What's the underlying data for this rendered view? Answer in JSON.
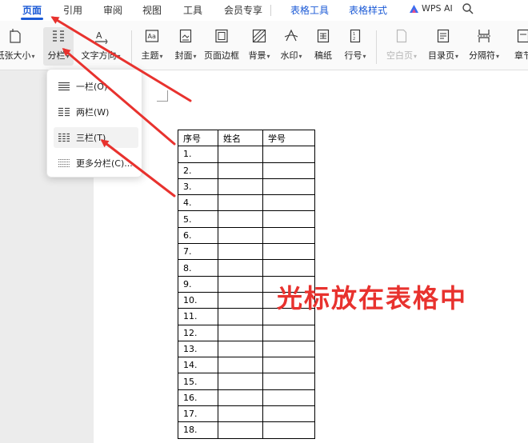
{
  "menu": {
    "tabs": [
      "页面",
      "引用",
      "审阅",
      "视图",
      "工具",
      "会员专享"
    ],
    "table_tabs": [
      "表格工具",
      "表格样式"
    ],
    "wps_ai": "WPS AI"
  },
  "ribbon": {
    "paper_size": "纸张大小",
    "columns": "分栏",
    "text_direction": "文字方向",
    "theme": "主题",
    "cover": "封面",
    "page_border": "页面边框",
    "background": "背景",
    "watermark": "水印",
    "manuscript": "稿纸",
    "line_number": "行号",
    "blank_page": "空白页",
    "toc_page": "目录页",
    "separator": "分隔符",
    "section": "章节"
  },
  "columns_menu": {
    "items": [
      "一栏(O)",
      "两栏(W)",
      "三栏(T)",
      "更多分栏(C)..."
    ]
  },
  "table": {
    "headers": [
      "序号",
      "姓名",
      "学号"
    ],
    "rows": [
      "1.",
      "2.",
      "3.",
      "4.",
      "5.",
      "6.",
      "7.",
      "8.",
      "9.",
      "10.",
      "11.",
      "12.",
      "13.",
      "14.",
      "15.",
      "16.",
      "17.",
      "18."
    ]
  },
  "annotation": "光标放在表格中",
  "colors": {
    "accent": "#1b5ad6",
    "annotation": "#e8322e"
  }
}
